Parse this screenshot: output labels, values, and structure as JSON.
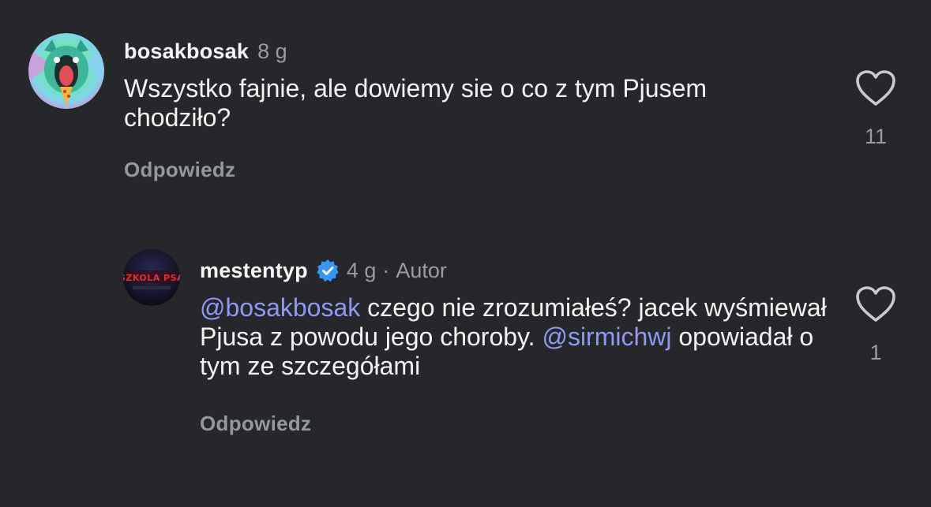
{
  "comments": [
    {
      "username": "bosakbosak",
      "time": "8 g",
      "text": "Wszystko fajnie, ale dowiemy sie o co z tym Pjusem chodziło?",
      "reply_label": "Odpowiedz",
      "likes": "11",
      "avatar_icon": "cat-avatar"
    },
    {
      "username": "mestentyp",
      "verified": true,
      "time": "4 g",
      "separator": "·",
      "role": "Autor",
      "mention_1": "@bosakbosak",
      "text_1": " czego nie zrozumiałeś? jacek wyśmiewał Pjusa z powodu jego choroby. ",
      "mention_2": "@sirmichwj",
      "text_2": " opowiadał o tym ze szczegółami",
      "reply_label": "Odpowiedz",
      "likes": "1",
      "avatar_icon": "dark-logo-avatar"
    }
  ],
  "colors": {
    "background": "#25272b",
    "mention": "#8f98f2",
    "secondary_text": "#9a9ca1",
    "verified": "#3897f0"
  }
}
